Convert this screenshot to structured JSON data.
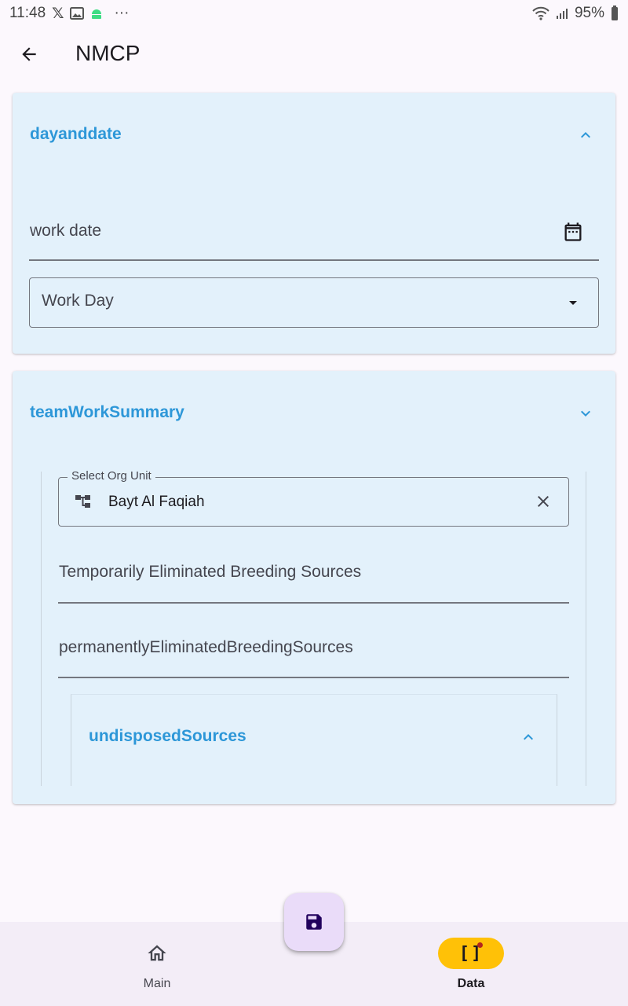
{
  "status_bar": {
    "time": "11:48",
    "notification_icons": [
      "x-icon",
      "image-icon",
      "android-icon"
    ],
    "more": "···",
    "battery": "95%"
  },
  "app_bar": {
    "title": "NMCP"
  },
  "section_dayanddate": {
    "title": "dayanddate",
    "work_date_label": "work date",
    "work_day_label": "Work Day"
  },
  "section_team": {
    "title": "teamWorkSummary",
    "org_unit_label": "Select Org Unit",
    "org_unit_value": "Bayt Al Faqiah",
    "temp_label": "Temporarily Eliminated Breeding Sources",
    "perm_label": "permanentlyEliminatedBreedingSources",
    "undisposed_title": "undisposedSources"
  },
  "bottom_nav": {
    "main_label": "Main",
    "data_label": "Data"
  },
  "colors": {
    "accent": "#2d97d8",
    "card_bg": "#e3f1fb",
    "nav_active": "#ffc107",
    "fab_bg": "#eadcf9"
  }
}
